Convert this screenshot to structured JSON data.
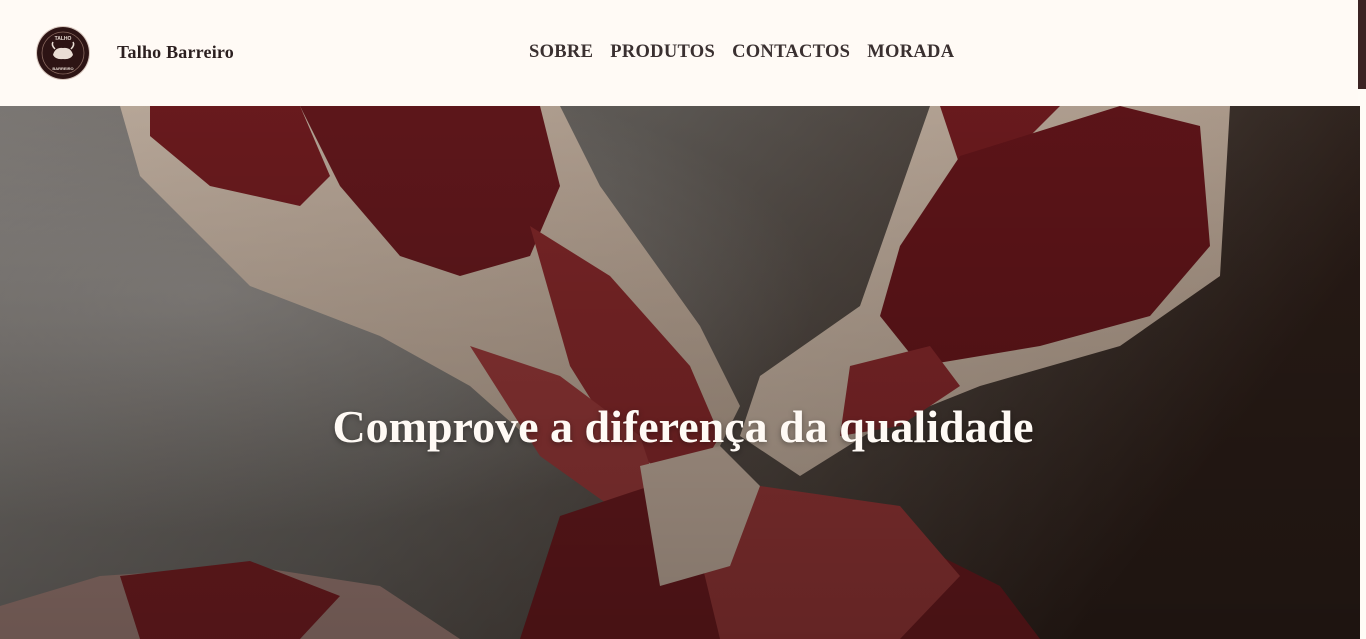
{
  "header": {
    "brand": "Talho Barreiro",
    "logo_text_top": "TALHO",
    "logo_text_bottom": "BARREIRO",
    "nav": [
      {
        "label": "SOBRE"
      },
      {
        "label": "PRODUTOS"
      },
      {
        "label": "CONTACTOS"
      },
      {
        "label": "MORADA"
      }
    ]
  },
  "hero": {
    "title": "Comprove a diferença da qualidade"
  },
  "colors": {
    "header_bg": "#fffaf5",
    "text_dark": "#2b1f1f",
    "accent": "#3b2323"
  }
}
